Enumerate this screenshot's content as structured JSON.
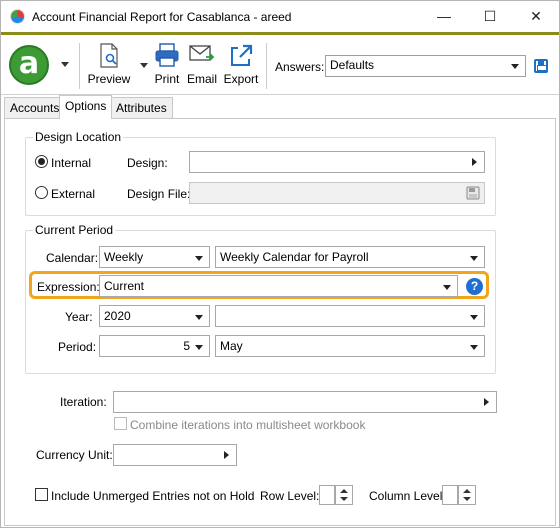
{
  "window": {
    "title": "Account Financial Report for Casablanca - areed",
    "minimize": "—",
    "maximize": "☐",
    "close": "✕"
  },
  "toolbar": {
    "logo_letter": "a",
    "preview_label": "Preview",
    "print_label": "Print",
    "email_label": "Email",
    "export_label": "Export",
    "answers_label": "Answers:",
    "answers_value": "Defaults"
  },
  "tabs": [
    {
      "label": "Accounts"
    },
    {
      "label": "Options"
    },
    {
      "label": "Attributes"
    }
  ],
  "design_location": {
    "title": "Design Location",
    "internal_label": "Internal",
    "external_label": "External",
    "design_label": "Design:",
    "design_value": "",
    "design_file_label": "Design File:",
    "design_file_value": ""
  },
  "current_period": {
    "title": "Current Period",
    "calendar_label": "Calendar:",
    "calendar_type": "Weekly",
    "calendar_name": "Weekly Calendar for Payroll",
    "expression_label": "Expression:",
    "expression_value": "Current",
    "year_label": "Year:",
    "year_value": "2020",
    "year_extra": "",
    "period_label": "Period:",
    "period_value": "5",
    "period_name": "May"
  },
  "iteration": {
    "label": "Iteration:",
    "value": "",
    "combine_label": "Combine iterations into multisheet workbook"
  },
  "currency": {
    "label": "Currency Unit:",
    "value": ""
  },
  "bottom": {
    "unmerged_label": "Include Unmerged Entries not on Hold",
    "row_level_label": "Row Level:",
    "row_level_value": "",
    "column_level_label": "Column Level:",
    "column_level_value": ""
  },
  "colors": {
    "accent_rule": "#8c8c1a",
    "logo_green": "#3d9b35",
    "highlight": "#f2a51b",
    "help_blue": "#1f6fd0"
  }
}
